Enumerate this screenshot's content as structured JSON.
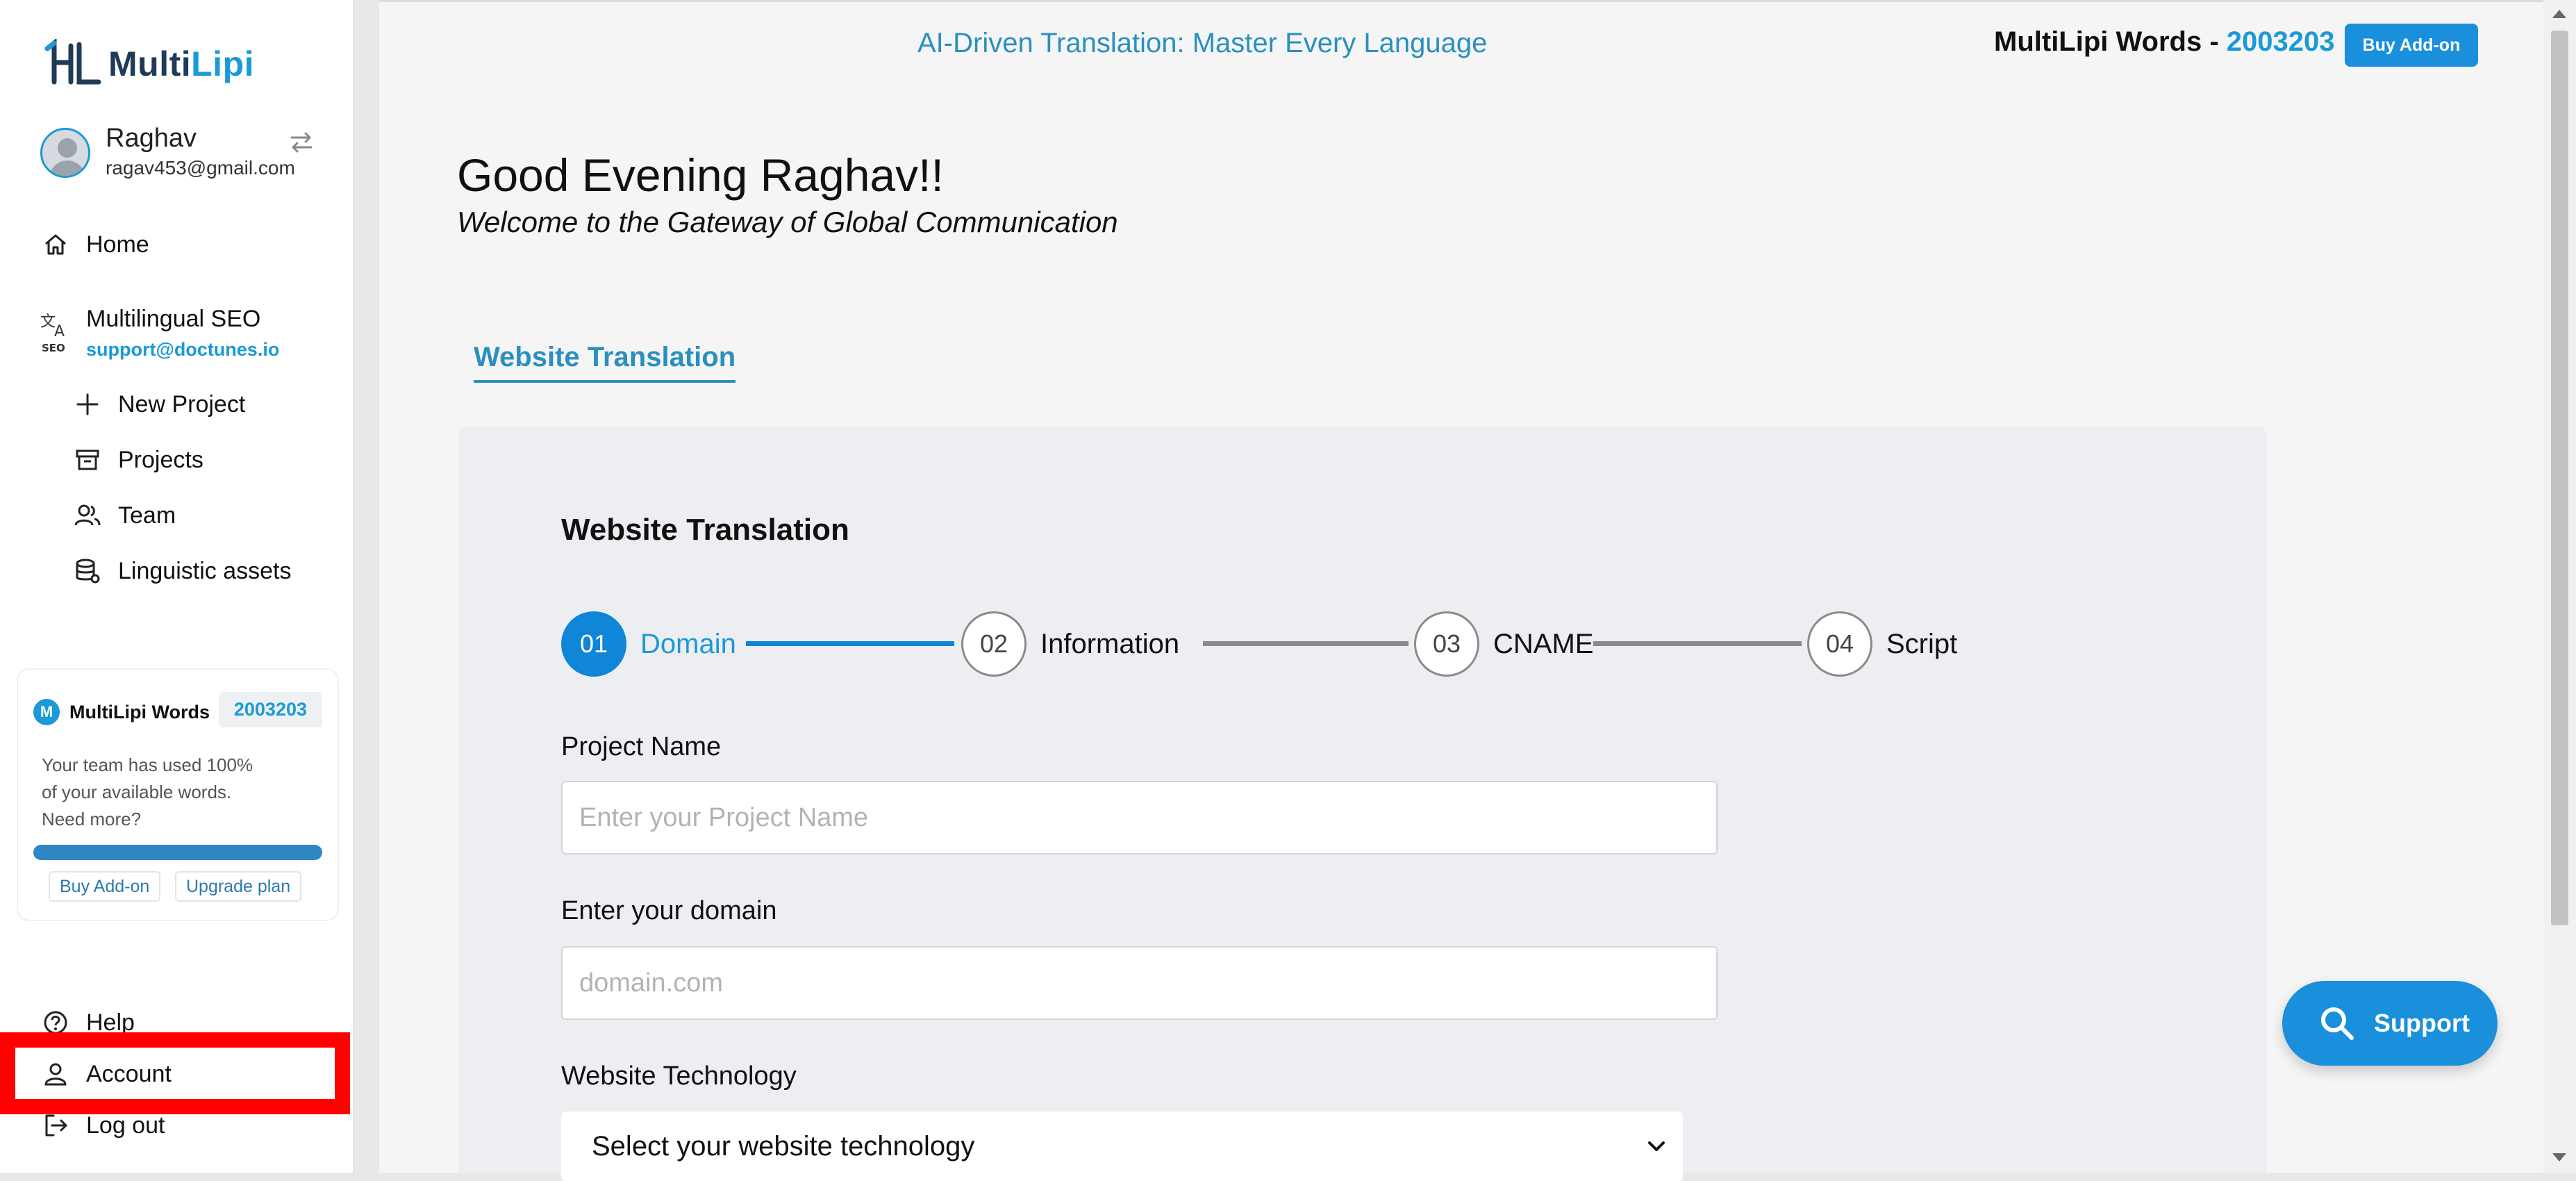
{
  "app": {
    "brand_prefix": "Multi",
    "brand_suffix": "Lipi"
  },
  "user": {
    "name": "Raghav",
    "email": "ragav453@gmail.com"
  },
  "sidebar": {
    "home": "Home",
    "seo_title": "Multilingual SEO",
    "seo_email": "support@doctunes.io",
    "new_project": "New Project",
    "projects": "Projects",
    "team": "Team",
    "linguistic_assets": "Linguistic assets",
    "help": "Help",
    "account": "Account",
    "logout": "Log out"
  },
  "words_card": {
    "title": "MultiLipi Words",
    "logo_letter": "M",
    "count": "2003203",
    "message": "Your team has used 100% of your available words. Need more?",
    "usage_percent": 100,
    "buy_addon": "Buy Add-on",
    "upgrade": "Upgrade plan"
  },
  "header": {
    "tagline": "AI-Driven Translation: Master Every Language",
    "words_label": "MultiLipi Words - ",
    "words_count": "2003203",
    "buy_addon": "Buy Add-on"
  },
  "greeting": {
    "title": "Good Evening Raghav!!",
    "subtitle": "Welcome to the Gateway of Global Communication"
  },
  "tab": "Website Translation",
  "form": {
    "title": "Website Translation",
    "steps": [
      {
        "num": "01",
        "label": "Domain"
      },
      {
        "num": "02",
        "label": "Information"
      },
      {
        "num": "03",
        "label": "CNAME"
      },
      {
        "num": "04",
        "label": "Script"
      }
    ],
    "active_step": 0,
    "project_name_label": "Project Name",
    "project_name_placeholder": "Enter your Project Name",
    "domain_label": "Enter your domain",
    "domain_placeholder": "domain.com",
    "technology_label": "Website Technology",
    "technology_value": "Select your website technology"
  },
  "support": "Support",
  "colors": {
    "accent": "#1a9ad6",
    "primary_button": "#1a8fdb",
    "highlight": "#ff0000"
  }
}
